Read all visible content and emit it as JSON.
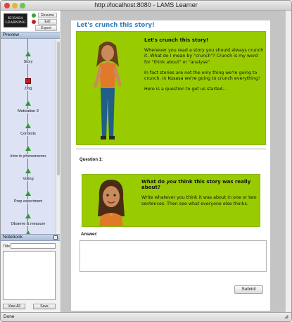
{
  "window": {
    "title": "http://localhost:8080 - LAMS Learner"
  },
  "sidebar": {
    "logo_lines": [
      "KUSASA",
      "LEARNING"
    ],
    "controls": {
      "resume": "Resume",
      "exit": "Exit",
      "export": "Export"
    },
    "preview_title": "Preview",
    "activities": [
      {
        "label": "Story",
        "state": "current"
      },
      {
        "label": "Zing",
        "state": "stop"
      },
      {
        "label": "Motivation 3",
        "state": "upcoming"
      },
      {
        "label": "Contexts",
        "state": "upcoming"
      },
      {
        "label": "Intro to phenomenon",
        "state": "upcoming"
      },
      {
        "label": "Voting",
        "state": "upcoming"
      },
      {
        "label": "Prep experiment",
        "state": "upcoming"
      },
      {
        "label": "Observe & measure",
        "state": "upcoming"
      }
    ],
    "notebook": {
      "title": "Notebook",
      "title_label": "Title",
      "view_all": "View All",
      "save": "Save"
    }
  },
  "main": {
    "page_title": "Let's crunch this story!",
    "intro": {
      "heading": "Let's crunch this story!",
      "p1": "Whenever you read a story you should always crunch it. What do I mean by \"crunch\"? Crunch is my word for \"think about\" or \"analyse\".",
      "p2": "In fact stories are not the only thing we're going to crunch. In Kusasa we're going to crunch everything!",
      "p3": "Here is a question to get us started..."
    },
    "question": {
      "label": "Question 1:",
      "heading_before": "What do ",
      "heading_em": "you",
      "heading_after": " think this story was really about?",
      "body": "Write whatever you think it was about in one or two sentences. Then see what everyone else thinks."
    },
    "answer_label": "Answer:",
    "submit": "Submit"
  },
  "status": {
    "text": "Done"
  },
  "colors": {
    "card_green": "#99cc00",
    "title_blue": "#2f7fbf",
    "node_green": "#2f9a2f",
    "stop_red": "#c21a1a",
    "preview_bg": "#dde3f4"
  },
  "icons": [
    "close-icon",
    "minimize-icon",
    "zoom-icon",
    "resume-icon",
    "exit-icon",
    "triangle-marker-icon",
    "stop-marker-icon",
    "collapse-icon"
  ]
}
